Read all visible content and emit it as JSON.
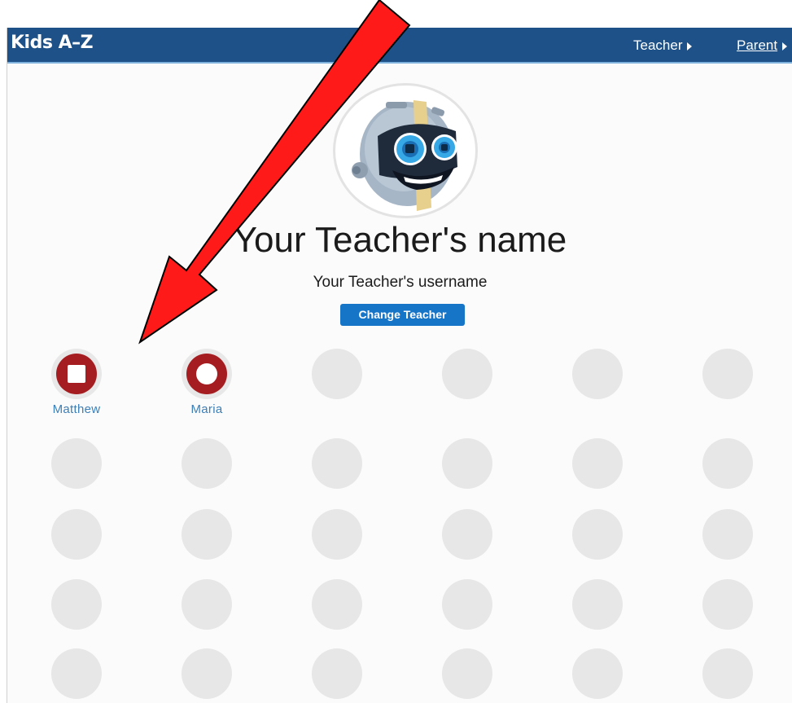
{
  "header": {
    "logo": "Kids A–Z",
    "teacher_link": "Teacher",
    "parent_link": "Parent"
  },
  "teacher": {
    "name": "Your Teacher's name",
    "username": "Your Teacher's username",
    "change_button": "Change Teacher"
  },
  "students": [
    {
      "name": "Matthew",
      "symbol": "square"
    },
    {
      "name": "Maria",
      "symbol": "circle"
    }
  ],
  "colors": {
    "header_bg": "#1d5187",
    "accent_blue": "#1775c8",
    "student_red": "#a51d21",
    "empty_slot": "#e7e7e7",
    "annotation_arrow": "#ff0000"
  },
  "icons": {
    "avatar": "robot-avatar-icon",
    "annotation": "red-arrow-annotation"
  }
}
